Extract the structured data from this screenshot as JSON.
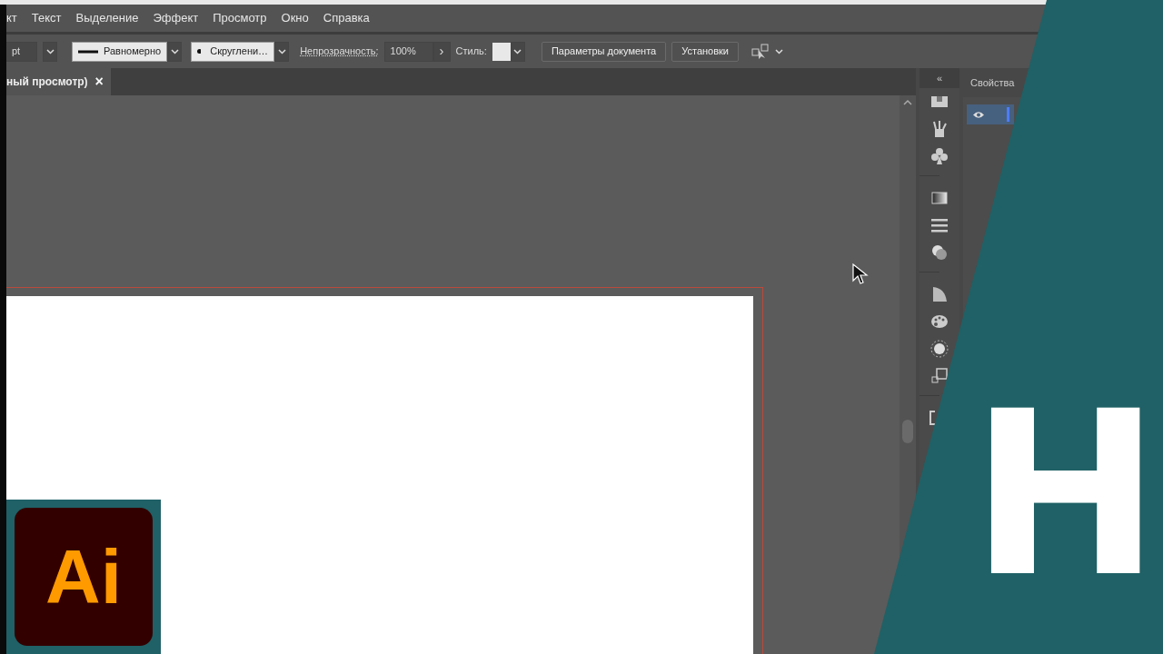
{
  "menu": [
    "кт",
    "Текст",
    "Выделение",
    "Эффект",
    "Просмотр",
    "Окно",
    "Справка"
  ],
  "control_bar": {
    "stroke_weight": "pt",
    "profile": "Равномерно",
    "brush": "Скруглени…",
    "opacity_label": "Непрозрачность:",
    "opacity": "100%",
    "opacity_arrow": "›",
    "style_label": "Стиль:",
    "buttons": [
      "Параметры документа",
      "Установки"
    ]
  },
  "document_tab": {
    "title": "ный просмотр)",
    "close": "×"
  },
  "panel": {
    "collapse": "«",
    "title": "Свойства",
    "layers": [
      {
        "visible": true,
        "selected": true
      }
    ]
  },
  "overlay": {
    "brand_letter": "H",
    "app_logo": "Ai"
  }
}
